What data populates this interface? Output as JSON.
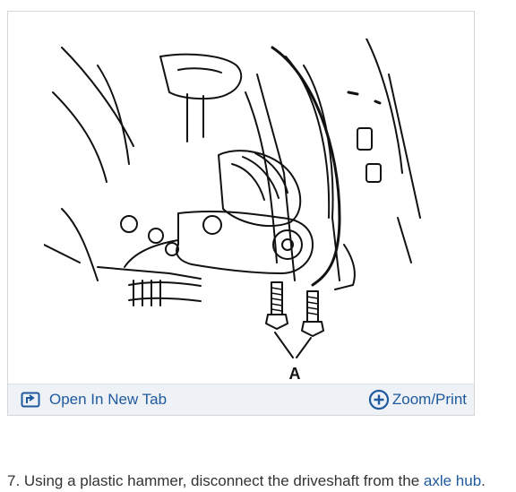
{
  "figure": {
    "callout_label": "A",
    "open_tab_label": "Open In New Tab",
    "zoom_label": "Zoom/Print"
  },
  "instruction": {
    "prefix": "7. Using a plastic hammer, disconnect the driveshaft from the ",
    "link_text": "axle hub",
    "suffix": "."
  },
  "colors": {
    "link": "#1f5a9e",
    "footer_bg": "#eef1f5"
  },
  "icons": [
    "open-new-tab-icon",
    "zoom-plus-icon"
  ]
}
